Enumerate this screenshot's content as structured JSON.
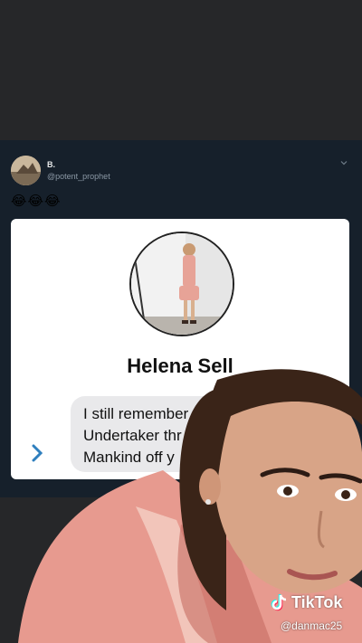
{
  "tweet": {
    "display_name": "B.",
    "handle": "@potent_prophet",
    "emojis": "😂😂😂"
  },
  "card": {
    "contact_name": "Helena Sell",
    "message_lines": [
      "I still remember y",
      "Undertaker thr",
      "Mankind off y"
    ]
  },
  "watermark": {
    "brand": "TikTok",
    "username": "@danmac25"
  },
  "colors": {
    "background": "#262729",
    "tweet_background": "#16202b",
    "bubble": "#e9e9eb",
    "chevron": "#2f7fbe"
  }
}
